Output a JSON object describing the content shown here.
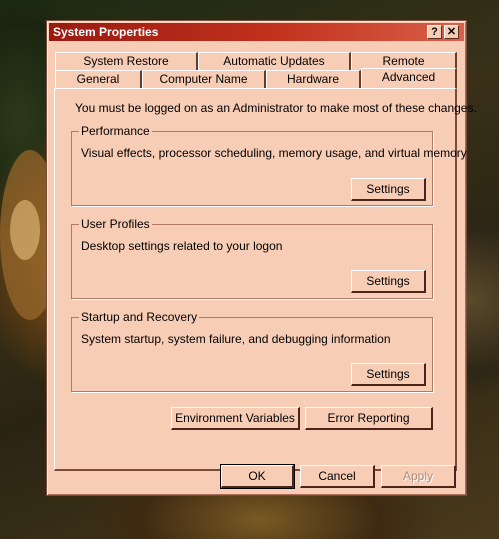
{
  "window": {
    "title": "System Properties",
    "help_glyph": "?",
    "close_glyph": "✕"
  },
  "tabs_back": [
    {
      "label": "System Restore"
    },
    {
      "label": "Automatic Updates"
    },
    {
      "label": "Remote"
    }
  ],
  "tabs_front": [
    {
      "label": "General"
    },
    {
      "label": "Computer Name"
    },
    {
      "label": "Hardware"
    },
    {
      "label": "Advanced",
      "active": true
    }
  ],
  "notice": "You must be logged on as an Administrator to make most of these changes.",
  "groups": {
    "performance": {
      "title": "Performance",
      "description": "Visual effects, processor scheduling, memory usage, and virtual memory",
      "button": "Settings"
    },
    "user_profiles": {
      "title": "User Profiles",
      "description": "Desktop settings related to your logon",
      "button": "Settings"
    },
    "startup_recovery": {
      "title": "Startup and Recovery",
      "description": "System startup, system failure, and debugging information",
      "button": "Settings"
    }
  },
  "buttons": {
    "environment_variables": "Environment Variables",
    "error_reporting": "Error Reporting",
    "ok": "OK",
    "cancel": "Cancel",
    "apply": "Apply"
  },
  "colors": {
    "dialog_face": "#f8cdb6",
    "titlebar_start": "#9a1a10",
    "titlebar_end": "#d9604a"
  }
}
